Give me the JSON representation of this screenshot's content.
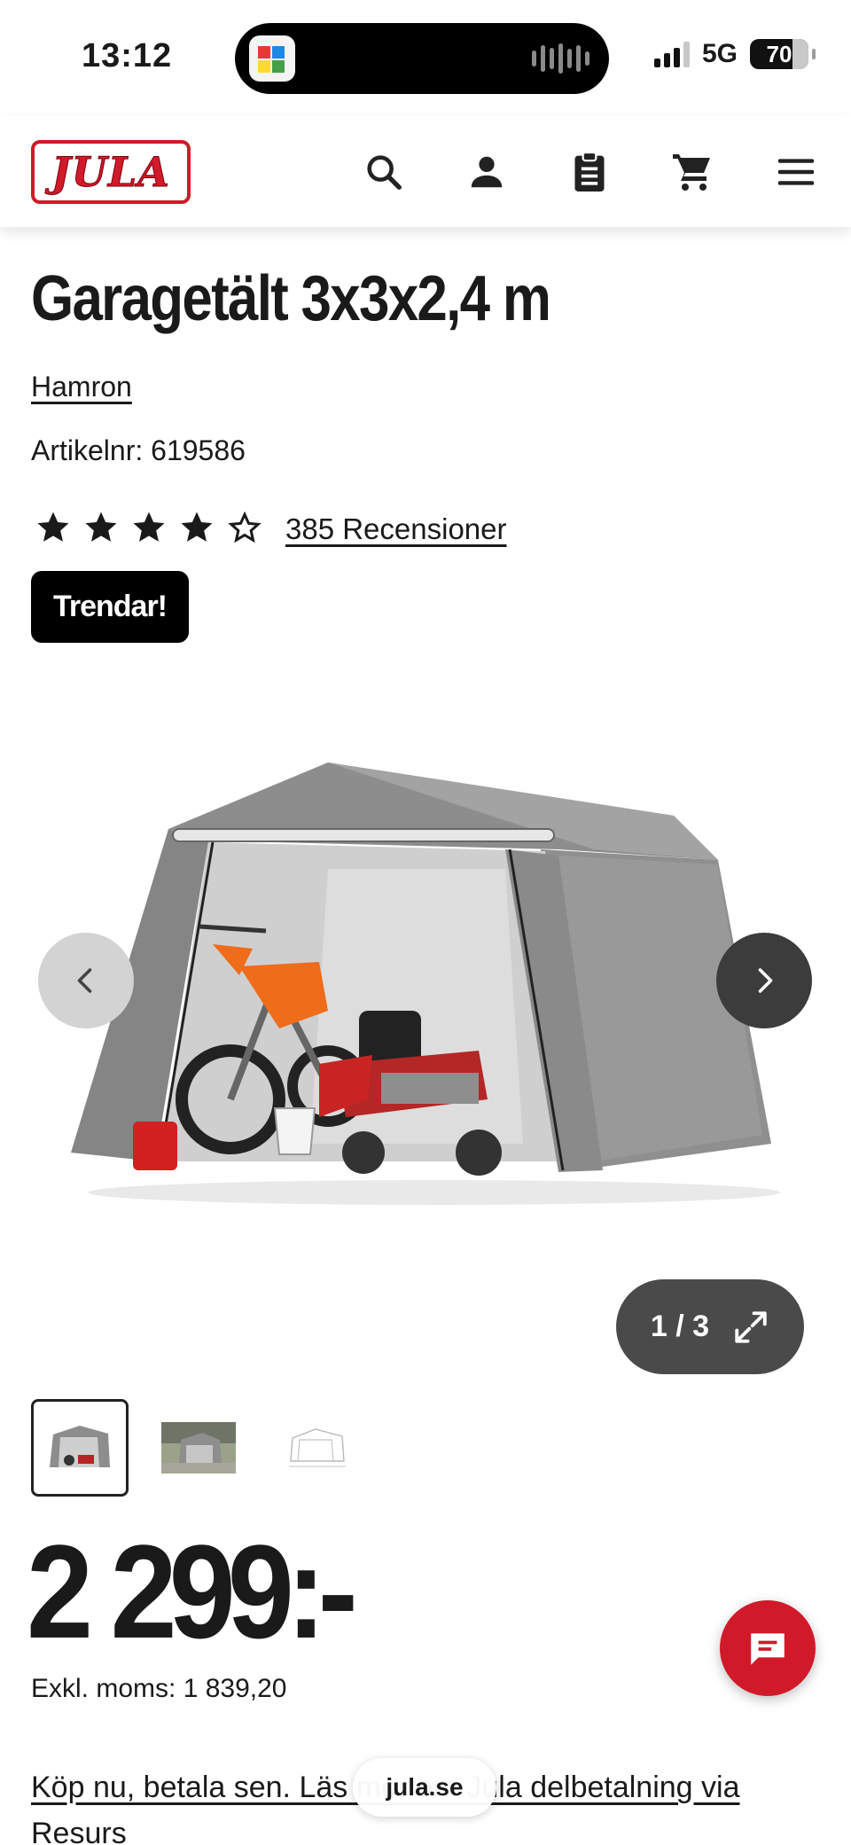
{
  "status_bar": {
    "time": "13:12",
    "network": "5G",
    "battery": "70"
  },
  "header": {
    "logo_text": "JULA",
    "icons": [
      "search-icon",
      "account-icon",
      "shopping-list-icon",
      "cart-icon",
      "menu-icon"
    ]
  },
  "product": {
    "title": "Garagetält 3x3x2,4 m",
    "brand": "Hamron",
    "sku_label": "Artikelnr:",
    "sku_value": "619586",
    "rating": 4,
    "rating_max": 5,
    "reviews_label": "385 Recensioner",
    "badge": "Trendar!"
  },
  "gallery": {
    "counter": "1 / 3",
    "current": 1,
    "total": 3
  },
  "pricing": {
    "price": "2 299:-",
    "vat_label": "Exkl. moms:",
    "vat_value": "1 839,20"
  },
  "financing": {
    "text": "Köp nu, betala sen. Läs mer om Jula delbetalning via Resurs"
  },
  "browser": {
    "url": "jula.se"
  },
  "colors": {
    "brand_red": "#d01a2a",
    "dark": "#1a1a1a"
  }
}
